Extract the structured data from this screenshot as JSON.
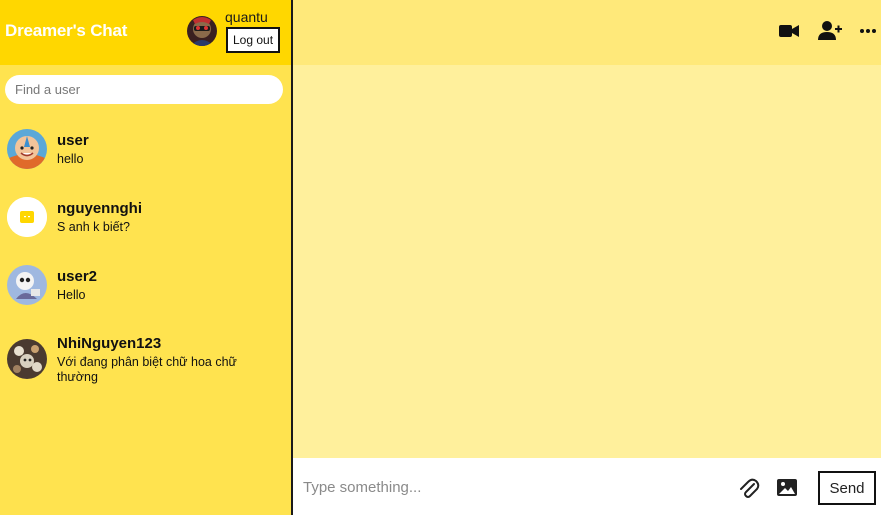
{
  "sidebar": {
    "brand": "Dreamer's Chat",
    "current_user": {
      "name": "quantu",
      "logout_label": "Log out"
    },
    "search": {
      "placeholder": "Find a user"
    },
    "chats": [
      {
        "name": "user",
        "last_message": "hello"
      },
      {
        "name": "nguyennghi",
        "last_message": "S anh k biết?"
      },
      {
        "name": "user2",
        "last_message": "Hello"
      },
      {
        "name": "NhiNguyen123",
        "last_message": "Với đang phân biệt chữ hoa chữ thường"
      }
    ]
  },
  "header": {
    "icons": [
      "video-camera-icon",
      "add-user-icon",
      "more-options-icon"
    ]
  },
  "composer": {
    "placeholder": "Type something...",
    "attach_icon": "paperclip-icon",
    "image_icon": "image-icon",
    "send_label": "Send"
  },
  "colors": {
    "sidebar_bg": "#ffe34f",
    "sidebar_header_bg": "#ffd700",
    "chat_header_bg": "#ffe97a",
    "messages_bg": "#fff09c"
  }
}
